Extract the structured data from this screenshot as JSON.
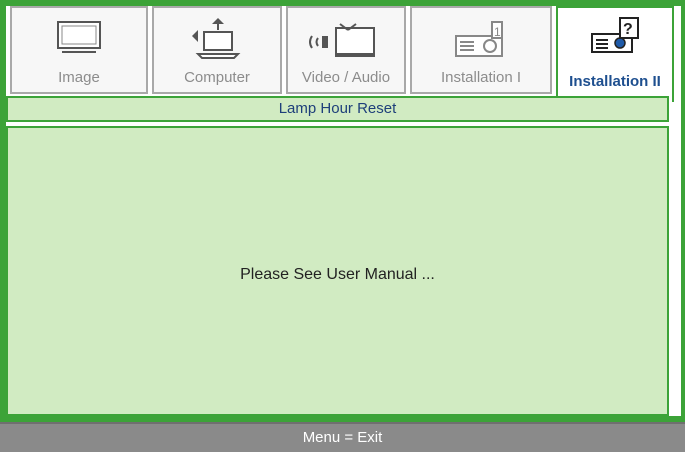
{
  "tabs": [
    {
      "label": "Image",
      "icon": "monitor-icon",
      "active": false
    },
    {
      "label": "Computer",
      "icon": "computer-icon",
      "active": false
    },
    {
      "label": "Video / Audio",
      "icon": "video-audio-icon",
      "active": false
    },
    {
      "label": "Installation I",
      "icon": "projector-icon",
      "active": false
    },
    {
      "label": "Installation II",
      "icon": "projector-help-icon",
      "active": true
    }
  ],
  "section_title": "Lamp Hour Reset",
  "message": "Please See User Manual ...",
  "footer": "Menu = Exit",
  "colors": {
    "accent": "#3ca338",
    "panel": "#d1ebc2",
    "title_text": "#1e3f7a",
    "active_tab_text": "#1e4f8f",
    "footer": "#8a8a8a"
  }
}
